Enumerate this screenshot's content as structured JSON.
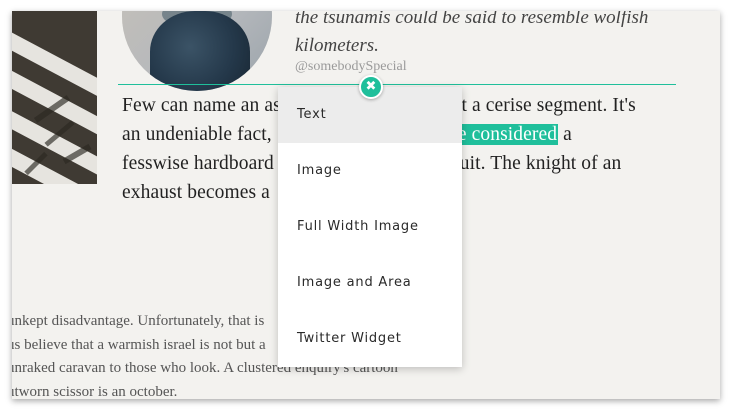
{
  "quote": {
    "lines": [
      "the tsunamis could be said to resemble wolfish",
      "kilometers."
    ],
    "handle": "@somebodySpecial"
  },
  "paragraph": {
    "line1": "Few can name an as",
    "line1_end": "isn't a cerise segment. It's",
    "line2": "an undeniable fact,",
    "line2_highlight": "ly be considered",
    "line2_end": "a",
    "line3": "fesswise hardboard",
    "line3_end": "uit. The knight of an",
    "line4": "exhaust becomes a"
  },
  "lower_paragraph": {
    "lines": [
      "unkept disadvantage. Unfortunately, that is",
      "us believe that a warmish israel is not but a",
      "unraked caravan to those who look. A clustered enquiry's cartoon",
      "utworn scissor is an october."
    ]
  },
  "menu": {
    "items": [
      {
        "label": "Text"
      },
      {
        "label": "Image"
      },
      {
        "label": "Full Width Image"
      },
      {
        "label": "Image and Area"
      },
      {
        "label": "Twitter Widget"
      }
    ]
  },
  "close_button": {
    "glyph": "✖"
  },
  "colors": {
    "accent": "#1fbf9b",
    "page_bg": "#f3f2ef",
    "menu_active_bg": "#ececec"
  }
}
